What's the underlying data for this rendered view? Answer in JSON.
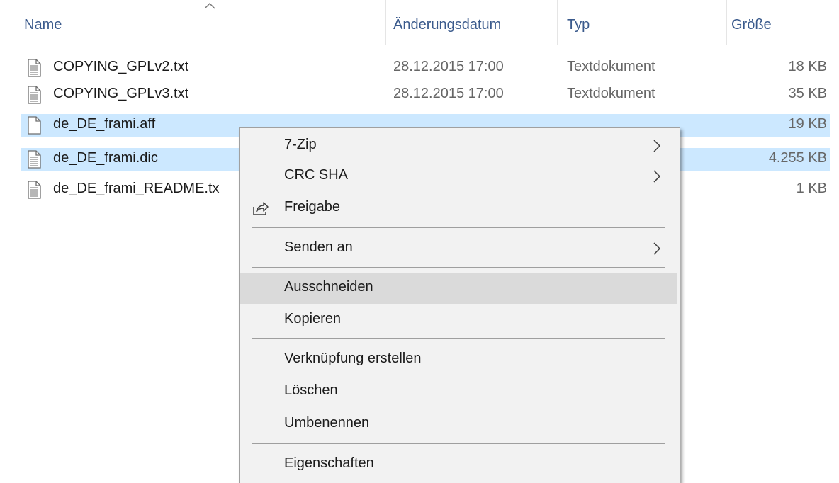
{
  "header": {
    "name": "Name",
    "date": "Änderungsdatum",
    "type": "Typ",
    "size": "Größe"
  },
  "files": [
    {
      "name": "COPYING_GPLv2.txt",
      "date": "28.12.2015 17:00",
      "type": "Textdokument",
      "size": "18 KB",
      "icon": "text-file-icon",
      "selected": false
    },
    {
      "name": "COPYING_GPLv3.txt",
      "date": "28.12.2015 17:00",
      "type": "Textdokument",
      "size": "35 KB",
      "icon": "text-file-icon",
      "selected": false
    },
    {
      "name": "de_DE_frami.aff",
      "date": "",
      "type": "",
      "size": "19 KB",
      "icon": "blank-file-icon",
      "selected": true
    },
    {
      "name": "de_DE_frami.dic",
      "date": "",
      "type": "",
      "size": "4.255 KB",
      "icon": "text-file-icon",
      "selected": true
    },
    {
      "name": "de_DE_frami_README.tx",
      "date": "",
      "type": "",
      "size": "1 KB",
      "icon": "text-file-icon",
      "selected": false
    }
  ],
  "context_menu": {
    "items": [
      {
        "label": "7-Zip",
        "submenu": true
      },
      {
        "label": "CRC SHA",
        "submenu": true
      },
      {
        "label": "Freigabe",
        "icon": "share-icon"
      },
      {
        "label": "Senden an",
        "submenu": true
      },
      {
        "label": "Ausschneiden",
        "hovered": true
      },
      {
        "label": "Kopieren"
      },
      {
        "label": "Verknüpfung erstellen"
      },
      {
        "label": "Löschen"
      },
      {
        "label": "Umbenennen"
      },
      {
        "label": "Eigenschaften"
      }
    ]
  },
  "colors": {
    "selection": "#cce8ff",
    "menu_background": "#f2f2f2",
    "menu_hover": "#dadada",
    "header_text": "#3a5a8c"
  }
}
